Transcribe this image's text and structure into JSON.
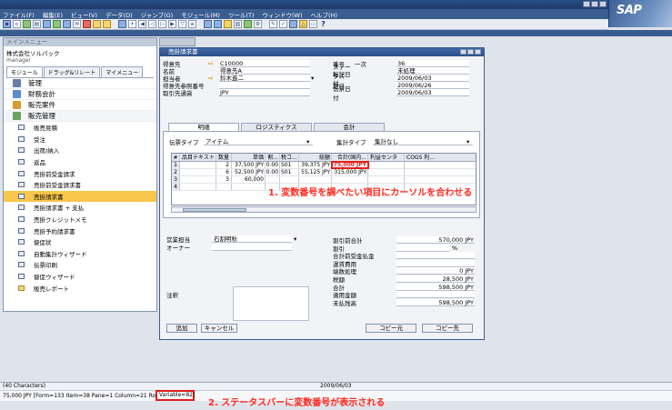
{
  "menubar": {
    "items": [
      "ファイル(F)",
      "編集(E)",
      "ビュー(V)",
      "データ(D)",
      "ジャンプ(G)",
      "モジュール(M)",
      "ツール(T)",
      "ウィンドウ(W)",
      "ヘルプ(H)"
    ]
  },
  "brand": {
    "logo_text": "SAP"
  },
  "main_menu": {
    "title": "メインメニュー",
    "company": "株式会社ソルパック",
    "user": "manager",
    "tabs": [
      "モジュール",
      "ドラッグ&リレート",
      "マイメニュー"
    ],
    "modules": [
      {
        "label": "管理",
        "color": "#6a7fa8"
      },
      {
        "label": "財務会計",
        "color": "#5c8ad0"
      },
      {
        "label": "販売案件",
        "color": "#d29c2e"
      },
      {
        "label": "販売管理",
        "color": "#6aa35a"
      }
    ],
    "sales_items": [
      {
        "label": "販売見積"
      },
      {
        "label": "受注"
      },
      {
        "label": "出荷/納入"
      },
      {
        "label": "返品"
      },
      {
        "label": "売掛前受金請求"
      },
      {
        "label": "売掛前受金請求書"
      },
      {
        "label": "売掛請求書"
      },
      {
        "label": "売掛請求書 + 支払"
      },
      {
        "label": "売掛クレジットメモ"
      },
      {
        "label": "売掛予約請求書"
      },
      {
        "label": "督促状"
      },
      {
        "label": "自動集計ウィザード"
      },
      {
        "label": "伝票印刷"
      },
      {
        "label": "督促ウィザード"
      },
      {
        "label": "販売レポート"
      }
    ],
    "highlight_index": 6
  },
  "sales_order": {
    "title": "売掛請求書",
    "fields_left": [
      {
        "label": "得意先",
        "value": "C10000",
        "arrow": true
      },
      {
        "label": "名前",
        "value": "得意先A",
        "arrow": false
      },
      {
        "label": "担当者",
        "value": "鈴木進二",
        "arrow": true
      },
      {
        "label": "得意先参照番号",
        "value": "",
        "arrow": false
      },
      {
        "label": "取引先通貨",
        "value": "JPY",
        "arrow": false
      }
    ],
    "fields_right": [
      {
        "label": "番号",
        "prefix": "一次",
        "value": "36"
      },
      {
        "label": "ステータス",
        "prefix": "",
        "value": "未処理"
      },
      {
        "label": "転記日付",
        "prefix": "",
        "value": "2009/06/03"
      },
      {
        "label": "期日",
        "prefix": "",
        "value": "2009/06/26"
      },
      {
        "label": "伝票日付",
        "prefix": "",
        "value": "2009/06/03"
      }
    ],
    "tabs": [
      "明細",
      "ロジスティクス",
      "会計"
    ],
    "content_type_label": "伝票タイプ",
    "content_type_value": "アイテム",
    "summary_type_label": "集計タイプ",
    "summary_type_value": "集計なし",
    "grid": {
      "headers": [
        "#",
        "品目テキスト",
        "数量",
        "単価",
        "割...",
        "税コ...",
        "総額",
        "合計(国内...",
        "利益センタ",
        "COGS 利..."
      ],
      "rows": [
        {
          "n": "1",
          "text": "",
          "qty": "2",
          "price": "37,500 JPY",
          "disc": "0.00",
          "tax": "S01",
          "gross": "39,375 JPY",
          "total": "75,000 JPY",
          "pc": "",
          "cogs": ""
        },
        {
          "n": "2",
          "text": "",
          "qty": "6",
          "price": "52,500 JPY",
          "disc": "0.00",
          "tax": "S01",
          "gross": "55,125 JPY",
          "total": "315,000 JPY",
          "pc": "",
          "cogs": ""
        },
        {
          "n": "3",
          "text": "",
          "qty": "3",
          "price": "60,000",
          "disc": "",
          "tax": "",
          "gross": "",
          "total": "",
          "pc": "",
          "cogs": ""
        },
        {
          "n": "4",
          "text": "",
          "qty": "",
          "price": "",
          "disc": "",
          "tax": "",
          "gross": "",
          "total": "",
          "pc": "",
          "cogs": ""
        }
      ]
    },
    "annotation_1": "1. 変数番号を調べたい項目にカーソルを合わせる",
    "employee_label": "営業担当",
    "employee_value": "石割明秋",
    "owner_label": "オーナー",
    "remarks_label": "注釈",
    "totals": [
      {
        "label": "割引前合計",
        "value": "570,000 JPY"
      },
      {
        "label": "割引",
        "value": ""
      },
      {
        "label": "合計前受金払金",
        "value": ""
      },
      {
        "label": "運賃費用",
        "value": ""
      },
      {
        "label": "端数処理",
        "value": "0 JPY"
      },
      {
        "label": "税額",
        "value": "28,500 JPY"
      },
      {
        "label": "合計",
        "value": "598,500 JPY"
      },
      {
        "label": "適用金額",
        "value": ""
      },
      {
        "label": "未払残高",
        "value": "598,500 JPY"
      }
    ],
    "discount_unit": "%",
    "buttons": {
      "add": "追加",
      "cancel": "キャンセル",
      "copy_from": "コピー元",
      "copy_to": "コピー先"
    }
  },
  "status": {
    "chars": "(40 Characters)",
    "date": "2009/06/03",
    "detail": "75,000 JPY [Form=133 Item=38 Pane=1 Column=21 Row=",
    "variable": "Variable=82]",
    "annotation_2": "2. ステータスバーに変数番号が表示される"
  }
}
